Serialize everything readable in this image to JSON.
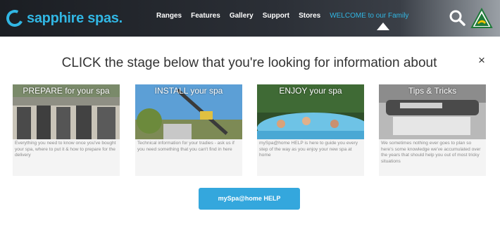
{
  "header": {
    "logo_text": "sapphire spas.",
    "nav": [
      "Ranges",
      "Features",
      "Gallery",
      "Support",
      "Stores"
    ],
    "welcome": "WELCOME to our Family",
    "search_icon": "search-icon",
    "badge_icon": "australian-made-badge-icon"
  },
  "modal": {
    "title": "CLICK the stage below that you're looking for information about",
    "close_label": "×",
    "cards": [
      {
        "title": "PREPARE for your spa",
        "desc": "Everything you need to know once you've bought your spa, where to put it & how to prepare for the delivery"
      },
      {
        "title": "INSTALL your spa",
        "desc": "Technical information for your tradies - ask us if you need something that you can't find in here"
      },
      {
        "title": "ENJOY your spa",
        "desc": "mySpa@home HELP is here to guide you every step of the way as you enjoy your new spa at home"
      },
      {
        "title": "Tips & Tricks",
        "desc": "We sometimes nothing ever goes to plan so here's some knowledge we've accumulated over the years that should help you out of most tricky situations"
      }
    ],
    "help_button": "mySpa@home HELP"
  },
  "colors": {
    "accent": "#31b6e3",
    "button": "#34a7dd",
    "header_dark": "#1b1e23"
  }
}
